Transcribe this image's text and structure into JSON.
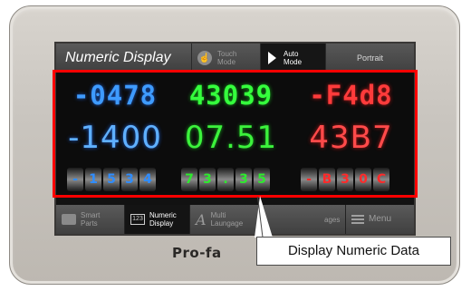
{
  "header": {
    "title": "Numeric Display",
    "touch_mode": {
      "line1": "Touch",
      "line2": "Mode"
    },
    "auto_mode": {
      "line1": "Auto",
      "line2": "Mode"
    },
    "portrait": "Portrait"
  },
  "displays": {
    "row1": {
      "blue": "-0478",
      "green": "43039",
      "red": "-F4d8"
    },
    "row2": {
      "blue": "-1400",
      "green": "07.51",
      "red": "43B7"
    },
    "row3": {
      "blue": [
        "-",
        "1",
        "5",
        "3",
        "4"
      ],
      "green": [
        "7",
        "3",
        ".",
        "3",
        "5"
      ],
      "red": [
        "-",
        "B",
        "3",
        "0",
        "C"
      ]
    }
  },
  "colors": {
    "blue": "#3e9bff",
    "green": "#35ff3d",
    "red": "#ff3b3b",
    "highlight": "#ff0000"
  },
  "nav": {
    "smart_parts": {
      "line1": "Smart",
      "line2": "Parts"
    },
    "numeric_display": {
      "line1": "Numeric",
      "line2": "Display"
    },
    "multi_language": {
      "line1": "Multi",
      "line2": "Laungage"
    },
    "images": {
      "line1": "",
      "line2": "ages"
    },
    "menu": "Menu"
  },
  "brand": "Pro-fa",
  "callout": "Display Numeric Data"
}
